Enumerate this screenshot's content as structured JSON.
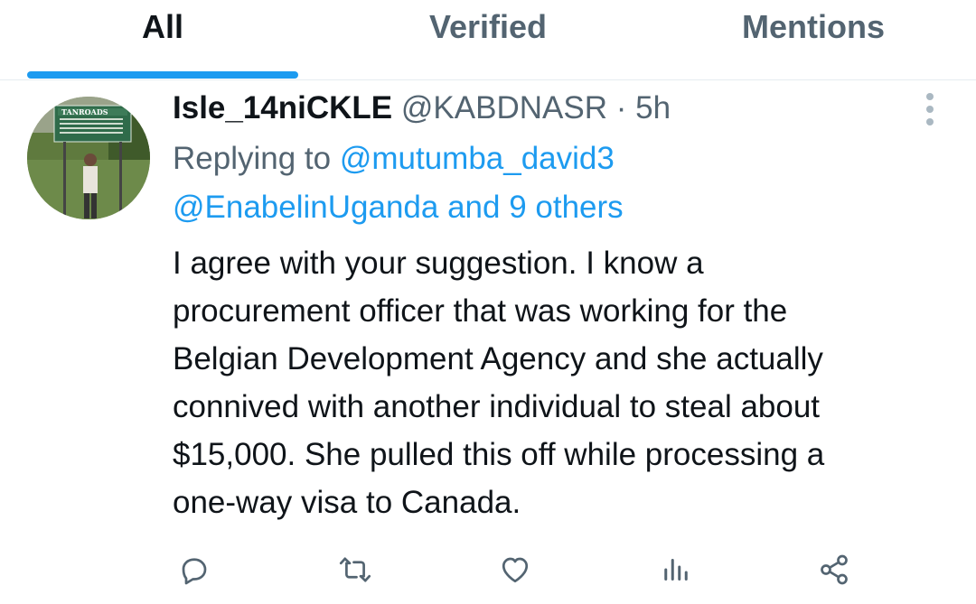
{
  "tabs": [
    {
      "label": "All",
      "active": true
    },
    {
      "label": "Verified",
      "active": false
    },
    {
      "label": "Mentions",
      "active": false
    }
  ],
  "accent_color": "#1d9bf0",
  "tweet": {
    "display_name": "Isle_14niCKLE",
    "handle": "@KABDNASR",
    "separator": "·",
    "time": "5h",
    "avatar_sign_text": "TANROADS",
    "replying_prefix": "Replying to ",
    "replying_user": "@mutumba_david3",
    "replying_others": "@EnabelinUganda and 9 others",
    "body_lines": [
      "I agree with your suggestion. I know a",
      "procurement officer that was working for the",
      "Belgian Development Agency and she actually",
      "connived with another individual to steal about",
      "$15,000. She pulled this off while processing a",
      "one-way visa to Canada."
    ],
    "actions": [
      {
        "name": "reply-icon"
      },
      {
        "name": "retweet-icon"
      },
      {
        "name": "like-icon"
      },
      {
        "name": "analytics-icon"
      },
      {
        "name": "share-icon"
      }
    ]
  }
}
